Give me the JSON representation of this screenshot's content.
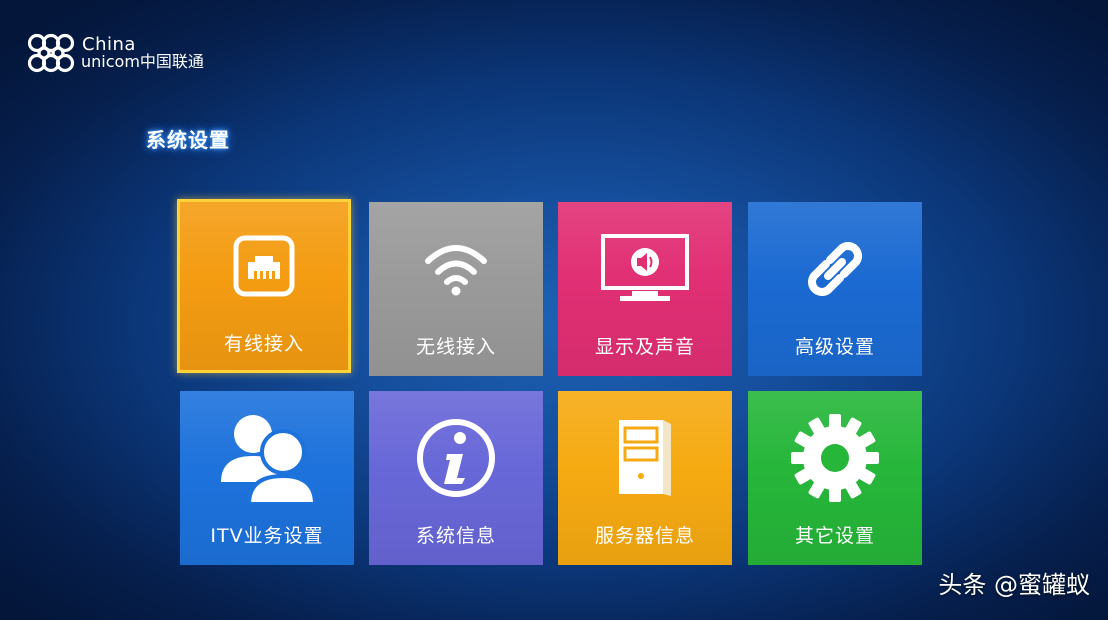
{
  "brand": {
    "line1": "China",
    "line2": "unicom中国联通"
  },
  "page": {
    "title": "系统设置"
  },
  "menu": {
    "selected_index": 0,
    "tiles": [
      {
        "label": "有线接入",
        "icon": "ethernet-port-icon",
        "color": "#f49c12"
      },
      {
        "label": "无线接入",
        "icon": "wifi-icon",
        "color": "#9a9a9a"
      },
      {
        "label": "显示及声音",
        "icon": "monitor-speaker-icon",
        "color": "#e12f74"
      },
      {
        "label": "高级设置",
        "icon": "link-chain-icon",
        "color": "#1b6ad2"
      },
      {
        "label": "ITV业务设置",
        "icon": "users-icon",
        "color": "#1d72dc"
      },
      {
        "label": "系统信息",
        "icon": "info-icon",
        "color": "#6867d8"
      },
      {
        "label": "服务器信息",
        "icon": "server-icon",
        "color": "#f6aa12"
      },
      {
        "label": "其它设置",
        "icon": "gear-icon",
        "color": "#26b63a"
      }
    ]
  },
  "watermark": {
    "text": "头条 @蜜罐蚁"
  }
}
